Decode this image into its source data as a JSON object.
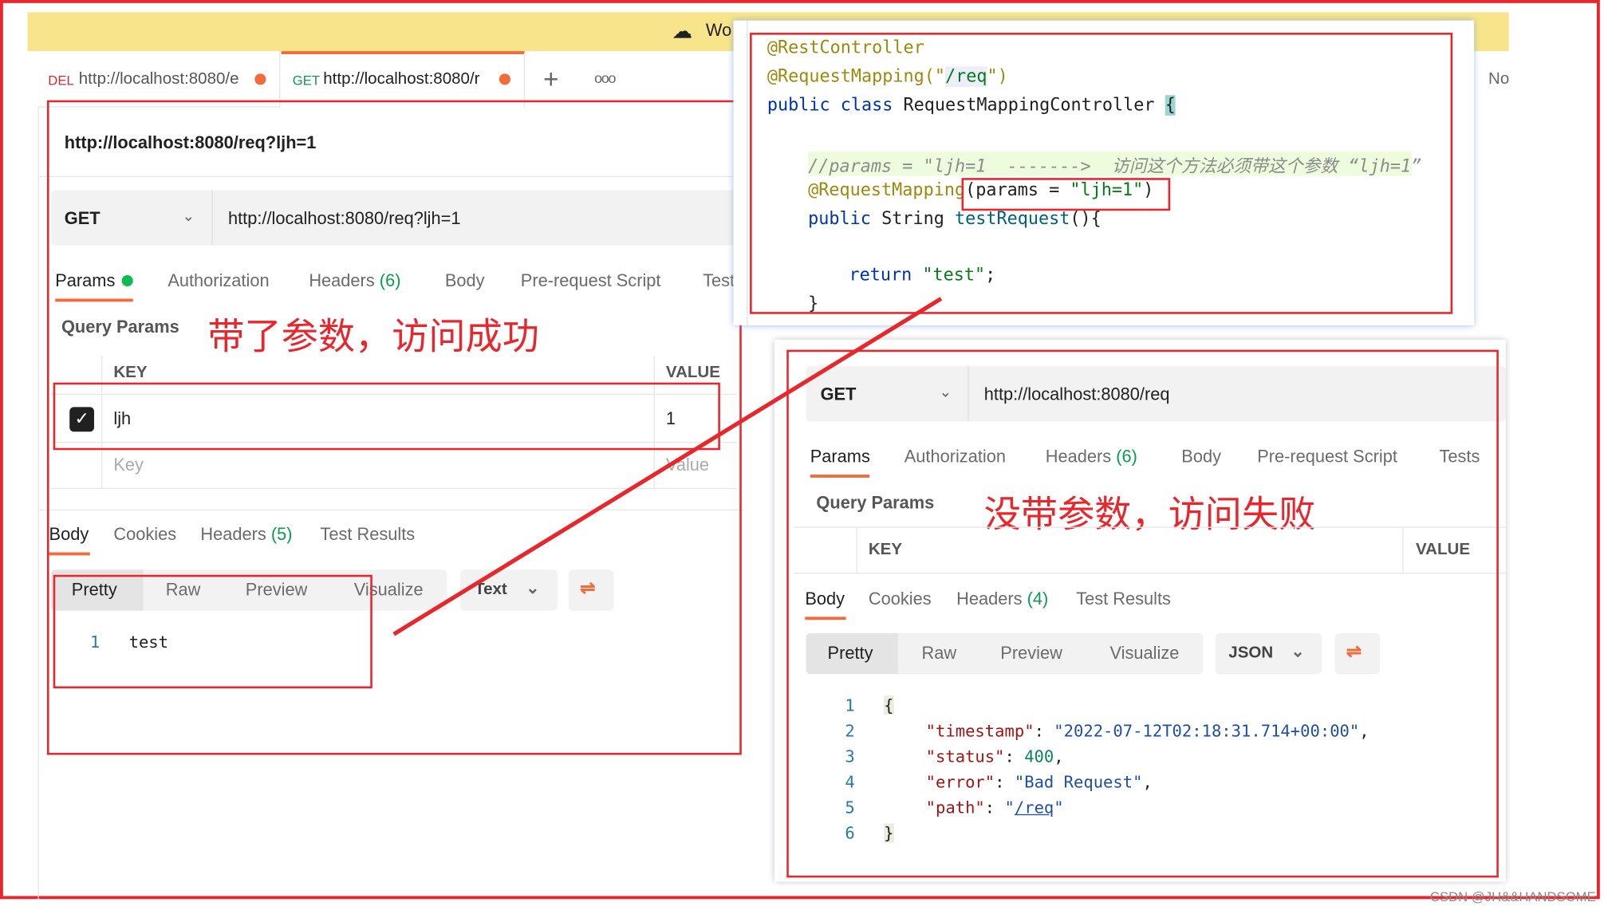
{
  "workspace_bar": {
    "label": "Wo",
    "icon": "cloud-off-icon"
  },
  "tabs": [
    {
      "method": "DEL",
      "url": "http://localhost:8080/e"
    },
    {
      "method": "GET",
      "url": "http://localhost:8080/r"
    }
  ],
  "right_fragment": "No",
  "left": {
    "title": "http://localhost:8080/req?ljh=1",
    "method": "GET",
    "url": "http://localhost:8080/req?ljh=1",
    "req_tabs": [
      "Params",
      "Authorization",
      "Headers",
      "(6)",
      "Body",
      "Pre-request Script",
      "Test"
    ],
    "query_params": "Query Params",
    "annotation": "带了参数，访问成功",
    "table": {
      "key_header": "KEY",
      "value_header": "VALUE",
      "rows": [
        {
          "key": "ljh",
          "value": "1",
          "checked": true
        }
      ],
      "key_placeholder": "Key",
      "value_placeholder": "Value"
    },
    "res_tabs": [
      "Body",
      "Cookies",
      "Headers",
      "(5)",
      "Test Results"
    ],
    "formats": [
      "Pretty",
      "Raw",
      "Preview",
      "Visualize"
    ],
    "format_type": "Text",
    "body_lines": [
      {
        "n": "1",
        "text": "test"
      }
    ]
  },
  "code": {
    "l1": "@RestController",
    "l2a": "@RequestMapping(\"",
    "l2b": "/req",
    "l2c": "\")",
    "l3a": "public class ",
    "l3b": "RequestMappingController ",
    "l3c": "{",
    "l4": "//params = \"ljh=1  ------->  访问这个方法必须带这个参数 “ljh=1”",
    "l5a": "@RequestMapping",
    "l5b": "(params = ",
    "l5c": "\"ljh=1\"",
    "l5d": ")",
    "l6a": "public ",
    "l6b": "String ",
    "l6c": "testRequest",
    "l6d": "(){",
    "l7a": "return ",
    "l7b": "\"test\"",
    "l7c": ";",
    "l8": "}"
  },
  "right": {
    "method": "GET",
    "url": "http://localhost:8080/req",
    "req_tabs": [
      "Params",
      "Authorization",
      "Headers",
      "(6)",
      "Body",
      "Pre-request Script",
      "Tests"
    ],
    "query_params": "Query Params",
    "annotation": "没带参数，访问失败",
    "table": {
      "key_header": "KEY",
      "value_header": "VALUE"
    },
    "res_tabs": [
      "Body",
      "Cookies",
      "Headers",
      "(4)",
      "Test Results"
    ],
    "formats": [
      "Pretty",
      "Raw",
      "Preview",
      "Visualize"
    ],
    "format_type": "JSON",
    "json": {
      "n": [
        "1",
        "2",
        "3",
        "4",
        "5",
        "6"
      ],
      "open": "{",
      "close": "}",
      "k1": "\"timestamp\"",
      "v1": "\"2022-07-12T02:18:31.714+00:00\"",
      "k2": "\"status\"",
      "v2": "400",
      "k3": "\"error\"",
      "v3": "\"Bad Request\"",
      "k4": "\"path\"",
      "v4": "/req"
    }
  },
  "watermark": "CSDN @JH&&HANDSOME",
  "colors": {
    "annotation_red": "#e8262b",
    "accent_orange": "#f26b3a",
    "workspace_yellow": "#f8e58b"
  }
}
